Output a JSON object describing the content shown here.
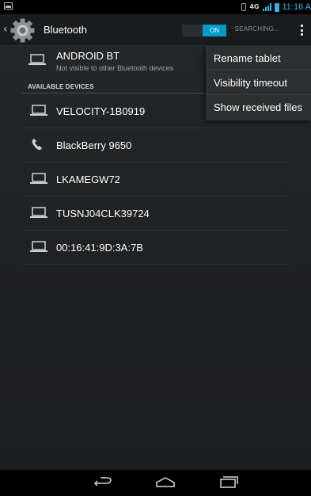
{
  "status_bar": {
    "network": "4G",
    "time": "11:16 A"
  },
  "action_bar": {
    "title": "Bluetooth",
    "toggle_label": "ON",
    "status": "SEARCHING..."
  },
  "my_device": {
    "name": "ANDROID BT",
    "subtitle": "Not visible to other Bluetooth devices",
    "icon": "laptop-icon"
  },
  "section_header": "AVAILABLE DEVICES",
  "devices": [
    {
      "name": "VELOCITY-1B0919",
      "icon": "laptop-icon"
    },
    {
      "name": "BlackBerry 9650",
      "icon": "phone-icon"
    },
    {
      "name": "LKAMEGW72",
      "icon": "laptop-icon"
    },
    {
      "name": "TUSNJ04CLK39724",
      "icon": "laptop-icon"
    },
    {
      "name": "00:16:41:9D:3A:7B",
      "icon": "laptop-icon"
    }
  ],
  "overflow_menu": [
    {
      "label": "Rename tablet"
    },
    {
      "label": "Visibility timeout"
    },
    {
      "label": "Show received files"
    }
  ],
  "colors": {
    "accent": "#33b5e5",
    "toggle_on": "#0099cc"
  }
}
